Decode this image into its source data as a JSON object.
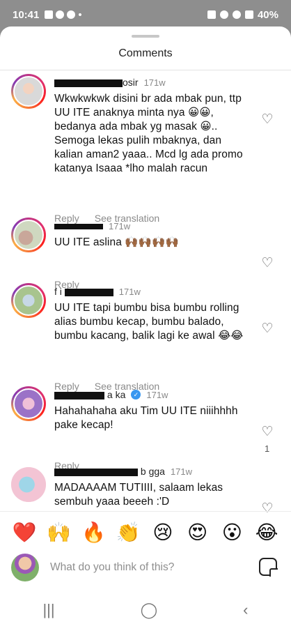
{
  "status_bar": {
    "time": "10:41",
    "dot": "•",
    "battery": "40%"
  },
  "sheet": {
    "title": "Comments"
  },
  "comments": [
    {
      "username": "osir",
      "time": "171w",
      "text": "Wkwkwkwk disini br ada mbak pun, ttp UU ITE anaknya minta nya 😀😀, bedanya ada mbak yg masak 😀.. Semoga lekas pulih mbaknya, dan kalian aman2 yaaa.. Mcd lg ada promo katanya Isaaa *lho malah racun",
      "reply": "Reply",
      "translate": "See translation",
      "likes": ""
    },
    {
      "username": "",
      "time": "171w",
      "text": "UU ITE aslina 🙌🏾🙌🏾🙌🏾🙌🏾",
      "reply": "Reply",
      "translate": "",
      "likes": ""
    },
    {
      "username": "f i",
      "time": "171w",
      "text": "UU ITE tapi bumbu bisa bumbu rolling alias bumbu kecap, bumbu balado, bumbu kacang, balik lagi ke awal 😂😂",
      "reply": "Reply",
      "translate": "See translation",
      "likes": ""
    },
    {
      "username": "a ka",
      "time": "171w",
      "text": "Hahahahaha aku Tim UU ITE niiihhhh pake kecap!",
      "reply": "Reply",
      "translate": "",
      "likes": "1"
    },
    {
      "username": "b gga",
      "time": "171w",
      "text": "MADAAAAM TUTIIII, salaam lekas sembuh yaaa beeeh :'D",
      "reply": "",
      "translate": "",
      "likes": ""
    }
  ],
  "reactions": [
    "❤️",
    "🙌",
    "🔥",
    "👏",
    "😢",
    "😍",
    "😮",
    "😂"
  ],
  "composer": {
    "placeholder": "What do you think of this?"
  },
  "navbar": {
    "recents": "|||",
    "home": "◯",
    "back": "‹"
  }
}
